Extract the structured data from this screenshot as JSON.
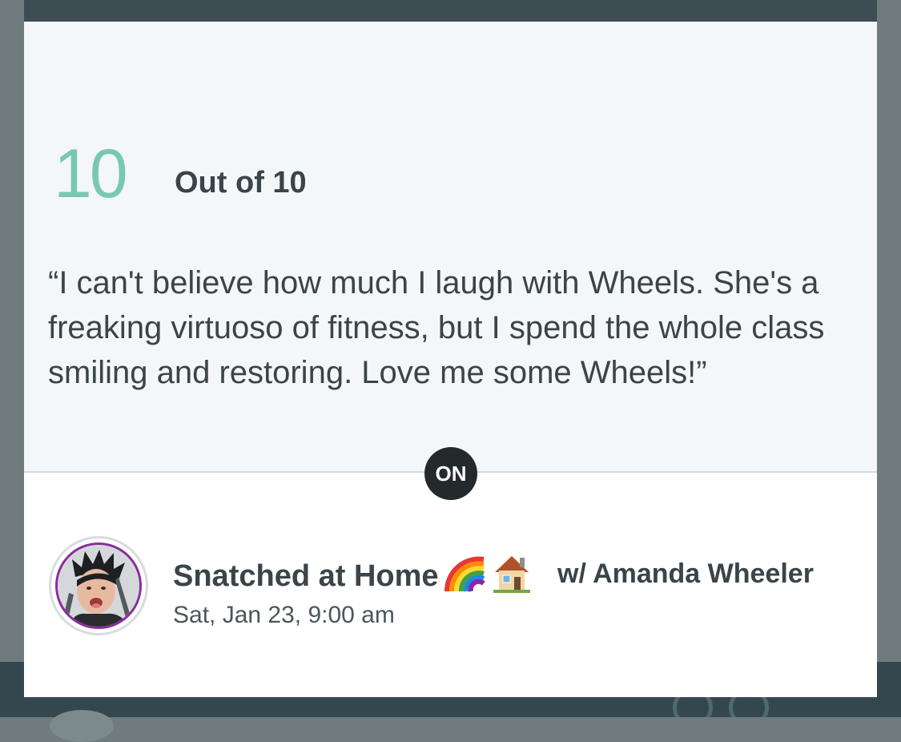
{
  "review": {
    "score": "10",
    "score_label": "Out of 10",
    "quote": "“I can't believe how much I laugh with Wheels. She's a freaking virtuoso of fitness, but I spend the whole class smiling and restoring. Love me some Wheels!”"
  },
  "badge": {
    "label": "ON"
  },
  "class_info": {
    "title": "Snatched at Home",
    "icons": [
      "rainbow-icon",
      "house-icon"
    ],
    "instructor": "w/ Amanda Wheeler",
    "datetime": "Sat, Jan 23, 9:00 am"
  },
  "colors": {
    "score": "#79c8b0",
    "text": "#3a4449",
    "badge": "#242a2c",
    "topbar": "#3e4d54",
    "avatar_ring": "#8a2d9c"
  }
}
